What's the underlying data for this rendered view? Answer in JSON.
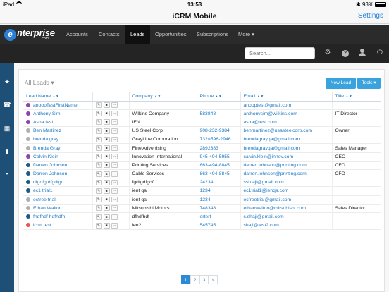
{
  "status_bar": {
    "device": "iPad",
    "time": "13:53",
    "battery": "93%"
  },
  "app": {
    "title": "iCRM Mobile",
    "settings_label": "Settings"
  },
  "logo": {
    "mark": "e",
    "text": "nterprise",
    "sub": ".com"
  },
  "nav": {
    "tabs": [
      {
        "label": "Accounts",
        "active": false
      },
      {
        "label": "Contacts",
        "active": false
      },
      {
        "label": "Leads",
        "active": true
      },
      {
        "label": "Opportunities",
        "active": false
      },
      {
        "label": "Subscriptions",
        "active": false
      },
      {
        "label": "More ▾",
        "active": false
      }
    ]
  },
  "toolbar": {
    "search_placeholder": "Search...",
    "icons": [
      "gear-icon",
      "help-icon",
      "user-icon",
      "power-icon"
    ]
  },
  "sidebar": {
    "icons": [
      "star-icon",
      "phone-icon",
      "calendar-icon",
      "chart-icon",
      "grid-icon"
    ]
  },
  "list": {
    "view_label": "All Leads ▾",
    "new_button": "New Lead",
    "tools_button": "Tools ▾",
    "columns": [
      "Lead Name",
      "",
      "Company",
      "Phone",
      "Email",
      "Title"
    ],
    "rows": [
      {
        "name": "anoopTestFirstName",
        "company": "",
        "phone": "",
        "email": "anooptest@gmail.com",
        "title": "",
        "dot": "#8e44ad"
      },
      {
        "name": "Anthony Sim",
        "company": "Wilkins Company",
        "phone": "583848",
        "email": "anthonysim@wilkins.com",
        "title": "IT Director",
        "dot": "#8e44ad"
      },
      {
        "name": "Asha test",
        "company": "IEN",
        "phone": "",
        "email": "asha@test.com",
        "title": "",
        "dot": "#8e44ad"
      },
      {
        "name": "Ben Martinez",
        "company": "US Steel Corp",
        "phone": "908-232-9384",
        "email": "benmartinez@usasteelcorp.com",
        "title": "Owner",
        "dot": "#b0b0b0"
      },
      {
        "name": "brenda gray",
        "company": "GrayLine Corporation",
        "phone": "732=596-2946",
        "email": "brendagrayqa@gmail.com",
        "title": "",
        "dot": "#b0b0b0"
      },
      {
        "name": "Brenda Gray",
        "company": "Fine Advertising",
        "phone": "2892383",
        "email": "brendagrayqa@gmail.com",
        "title": "Sales Manager",
        "dot": "#b0b0b0"
      },
      {
        "name": "Calvin Klein",
        "company": "Innovation International",
        "phone": "945-494-5955",
        "email": "calvin.klein@innov.com",
        "title": "CEO",
        "dot": "#8e44ad"
      },
      {
        "name": "Darren Johnson",
        "company": "Printing Services",
        "phone": "863-494-8845",
        "email": "darren.johnson@printing.com",
        "title": "CFO",
        "dot": "#1e5a86"
      },
      {
        "name": "Darren Johnson",
        "company": "Cable Services",
        "phone": "863-494-8845",
        "email": "darren.johnson@printing.com",
        "title": "CFO",
        "dot": "#1e5a86"
      },
      {
        "name": "dfgdfg dfgdfgd",
        "company": "fgdfgdfgdf",
        "phone": "24234",
        "email": "ssh.aji@gmail.com",
        "title": "",
        "dot": "#1e5a86"
      },
      {
        "name": "ec1 trial1",
        "company": "ient qa",
        "phone": "1234",
        "email": "ec1trial1@ienqa.com",
        "title": "",
        "dot": "#1e5a86"
      },
      {
        "name": "ecfree trial",
        "company": "ient qa",
        "phone": "1234",
        "email": "ecfreetrial@gmail.com",
        "title": "",
        "dot": "#b0b0b0"
      },
      {
        "name": "Ethan Walton",
        "company": "Mitsubishi Motors",
        "phone": "748348",
        "email": "ethanwalton@mitsubishi.com",
        "title": "Sales Director",
        "dot": "#b0b0b0"
      },
      {
        "name": "fhdfhdf hdfhdfh",
        "company": "dfhdfhdf",
        "phone": "ertert",
        "email": "s.shaji@gmail.com",
        "title": "",
        "dot": "#1e5a86"
      },
      {
        "name": "icrm test",
        "company": "ien2",
        "phone": "545745",
        "email": "shaji@test2.com",
        "title": "",
        "dot": "#e8564f"
      }
    ]
  },
  "pagination": {
    "pages": [
      "1",
      "2",
      "3",
      "»"
    ],
    "current": "1"
  },
  "colors": {
    "accent": "#1f7ac4",
    "nav": "#2b2b2b",
    "sidebar": "#1e4f77",
    "button": "#3aa3dd"
  }
}
